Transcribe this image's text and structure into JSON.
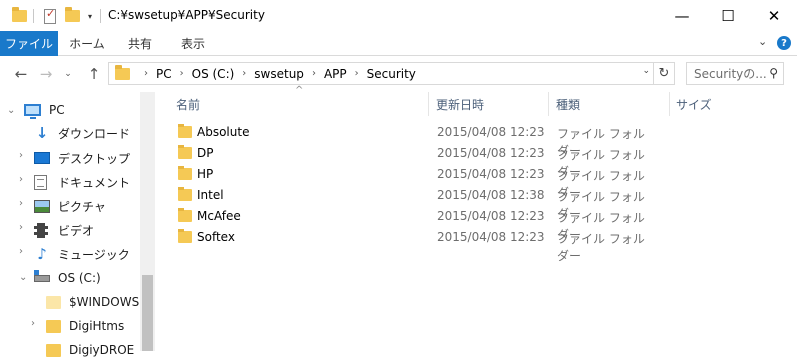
{
  "window": {
    "title": "C:¥swsetup¥APP¥Security",
    "controls": {
      "minimize": "—",
      "maximize": "☐",
      "close": "✕"
    }
  },
  "ribbon": {
    "tabs": [
      "ファイル",
      "ホーム",
      "共有",
      "表示"
    ],
    "expand_glyph": "⌄",
    "help_glyph": "?"
  },
  "address": {
    "breadcrumbs": [
      "PC",
      "OS (C:)",
      "swsetup",
      "APP",
      "Security"
    ],
    "search_placeholder": "Securityの..."
  },
  "nav_pane": {
    "items": [
      {
        "label": "PC",
        "icon": "pc-icon"
      },
      {
        "label": "ダウンロード",
        "icon": "download-icon"
      },
      {
        "label": "デスクトップ",
        "icon": "desktop-icon"
      },
      {
        "label": "ドキュメント",
        "icon": "documents-icon"
      },
      {
        "label": "ピクチャ",
        "icon": "pictures-icon"
      },
      {
        "label": "ビデオ",
        "icon": "videos-icon"
      },
      {
        "label": "ミュージック",
        "icon": "music-icon"
      },
      {
        "label": "OS (C:)",
        "icon": "drive-icon"
      },
      {
        "label": "$WINDOWS.~",
        "icon": "folder-icon"
      },
      {
        "label": "DigiHtms",
        "icon": "folder-icon"
      },
      {
        "label": "DigiyDROE",
        "icon": "folder-icon"
      }
    ]
  },
  "columns": {
    "name": "名前",
    "modified": "更新日時",
    "type": "種類",
    "size": "サイズ"
  },
  "files": [
    {
      "name": "Absolute",
      "modified": "2015/04/08 12:23",
      "type": "ファイル フォルダー"
    },
    {
      "name": "DP",
      "modified": "2015/04/08 12:23",
      "type": "ファイル フォルダー"
    },
    {
      "name": "HP",
      "modified": "2015/04/08 12:23",
      "type": "ファイル フォルダー"
    },
    {
      "name": "Intel",
      "modified": "2015/04/08 12:38",
      "type": "ファイル フォルダー"
    },
    {
      "name": "McAfee",
      "modified": "2015/04/08 12:23",
      "type": "ファイル フォルダー"
    },
    {
      "name": "Softex",
      "modified": "2015/04/08 12:23",
      "type": "ファイル フォルダー"
    }
  ],
  "colors": {
    "accent": "#1979ca",
    "folder": "#f5c955",
    "header_text": "#4c607a"
  }
}
